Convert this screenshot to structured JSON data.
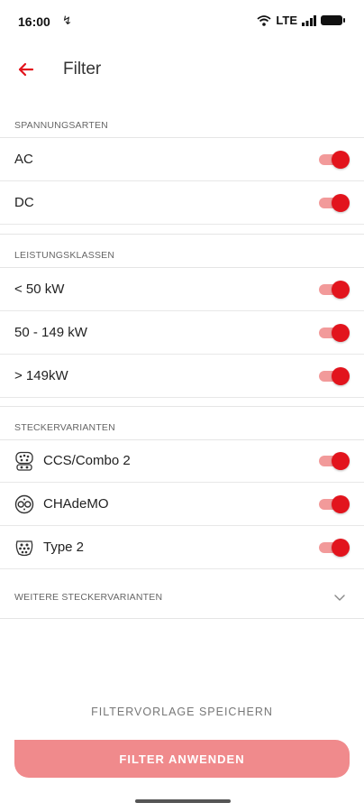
{
  "status_bar": {
    "time": "16:00",
    "sync_glyph": "↯",
    "network": "LTE"
  },
  "header": {
    "title": "Filter"
  },
  "sections": [
    {
      "title": "SPANNUNGSARTEN",
      "items": [
        {
          "label": "AC",
          "on": true
        },
        {
          "label": "DC",
          "on": true
        }
      ]
    },
    {
      "title": "LEISTUNGSKLASSEN",
      "items": [
        {
          "label": "< 50 kW",
          "on": true
        },
        {
          "label": "50 - 149 kW",
          "on": true
        },
        {
          "label": "> 149kW",
          "on": true
        }
      ]
    },
    {
      "title": "STECKERVARIANTEN",
      "items": [
        {
          "label": "CCS/Combo 2",
          "icon": "ccs-plug-icon",
          "on": true
        },
        {
          "label": "CHAdeMO",
          "icon": "chademo-plug-icon",
          "on": true
        },
        {
          "label": "Type 2",
          "icon": "type2-plug-icon",
          "on": true
        }
      ]
    }
  ],
  "more": {
    "label": "WEITERE STECKERVARIANTEN",
    "icon": "chevron-down-icon"
  },
  "footer": {
    "save_label": "FILTERVORLAGE SPEICHERN",
    "apply_label": "FILTER ANWENDEN"
  },
  "colors": {
    "accent": "#e2141d",
    "toggle_track": "#f29a9a",
    "button": "#f08a8c"
  }
}
